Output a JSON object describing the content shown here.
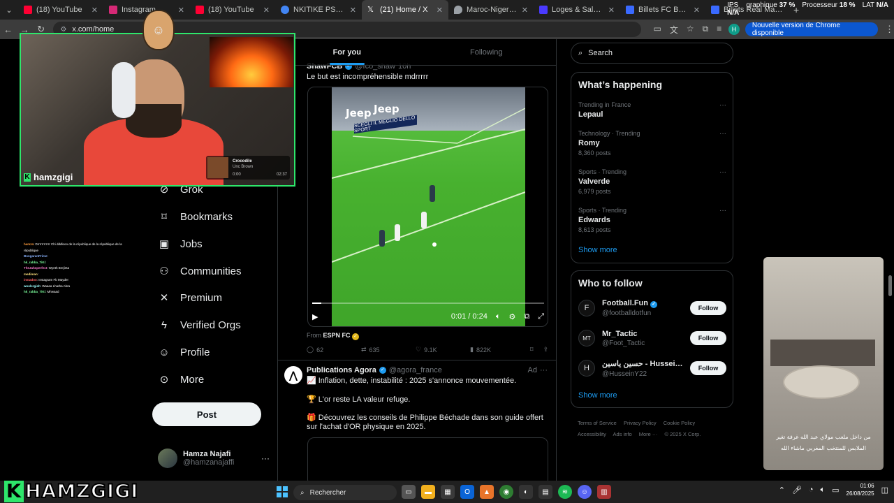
{
  "browser": {
    "tabs": [
      {
        "title": "(18) YouTube",
        "icon": "youtube-icon",
        "color": "#ff0033"
      },
      {
        "title": "Instagram",
        "icon": "instagram-icon",
        "color": "#d62976"
      },
      {
        "title": "(18) YouTube",
        "icon": "youtube-icon",
        "color": "#ff0033"
      },
      {
        "title": "NKITIKE PSGH - Rech",
        "icon": "google-icon",
        "color": "#4285f4"
      },
      {
        "title": "(21) Home / X",
        "icon": "x-icon",
        "color": "#ffffff"
      },
      {
        "title": "Maroc-Niger : billett",
        "icon": "map-pin-icon",
        "color": "#9aa0a6"
      },
      {
        "title": "Loges & Salons VIP",
        "icon": "bookmark-site-icon",
        "color": "#4a3aff"
      },
      {
        "title": "Billets FC Barcelona",
        "icon": "ticket-site-icon",
        "color": "#3a6aff"
      },
      {
        "title": "Billets Real Madrid",
        "icon": "ticket-site-icon",
        "color": "#3a6aff"
      }
    ],
    "url": "x.com/home",
    "update_label": "Nouvelle version de Chrome disponible",
    "profile_initial": "H"
  },
  "system_stats": {
    "ips_label": "IPS",
    "ips_value": "N/A",
    "gpu_label": "graphique",
    "gpu_value": "37 %",
    "cpu_label": "Processeur",
    "cpu_value": "18 %",
    "lat_label": "LAT",
    "lat_value": "N/A"
  },
  "sidebar": {
    "items": [
      {
        "label": "Grok",
        "icon": "grok-icon"
      },
      {
        "label": "Bookmarks",
        "icon": "bookmark-icon"
      },
      {
        "label": "Jobs",
        "icon": "briefcase-icon"
      },
      {
        "label": "Communities",
        "icon": "communities-icon"
      },
      {
        "label": "Premium",
        "icon": "x-logo-icon"
      },
      {
        "label": "Verified Orgs",
        "icon": "lightning-icon"
      },
      {
        "label": "Profile",
        "icon": "profile-icon"
      },
      {
        "label": "More",
        "icon": "more-circle-icon"
      }
    ],
    "post_label": "Post",
    "account": {
      "name": "Hamza Najafi",
      "handle": "@hamzanajaffi"
    }
  },
  "timeline": {
    "tabs": [
      "For you",
      "Following"
    ],
    "tweet1": {
      "name": "ShawFCB",
      "handle": "@fco_shaw",
      "badge": "illisible",
      "time": "10h",
      "text": "Le but est incompréhensible mdrrrrr",
      "board_text": "Jeep",
      "banner_text": "SCEGLI IL MEGLIO DELLO SPORT",
      "video_time": "0:01 / 0:24",
      "video_progress": 0.04,
      "from_label": "From",
      "from_source": "ESPN FC",
      "replies": "62",
      "reposts": "635",
      "likes": "9.1K",
      "views": "822K"
    },
    "tweet2": {
      "name": "Publications Agora",
      "handle": "@agora_france",
      "ad_label": "Ad",
      "line1": "📈 Inflation, dette, instabilité : 2025 s'annonce mouvementée.",
      "line2": "🏆 L'or reste LA valeur refuge.",
      "line3": "🎁 Découvrez les conseils de Philippe Béchade dans son guide offert sur l'achat d'OR physique en 2025."
    }
  },
  "right": {
    "search_placeholder": "Search",
    "happening_title": "What’s happening",
    "trends": [
      {
        "context": "Trending in France",
        "topic": "Lepaul",
        "posts": ""
      },
      {
        "context": "Technology · Trending",
        "topic": "Romy",
        "posts": "8,360 posts"
      },
      {
        "context": "Sports · Trending",
        "topic": "Valverde",
        "posts": "6,979 posts"
      },
      {
        "context": "Sports · Trending",
        "topic": "Edwards",
        "posts": "8,613 posts"
      }
    ],
    "show_more": "Show more",
    "wtf_title": "Who to follow",
    "follow_label": "Follow",
    "suggestions": [
      {
        "name": "Football.Fun",
        "handle": "@footballdotfun",
        "avatar": "F"
      },
      {
        "name": "Mr_Tactic",
        "handle": "@Foot_Tactic",
        "avatar": "MT"
      },
      {
        "name": "حسين ياسين - Hussei...",
        "handle": "@HusseinY22",
        "avatar": "H"
      }
    ],
    "footer": [
      "Terms of Service",
      "Privacy Policy",
      "Cookie Policy",
      "Accessibility",
      "Ads info",
      "More ···",
      "© 2025 X Corp."
    ]
  },
  "overlay": {
    "streamer_name": "hamzgigi",
    "now_playing_title": "Crocodile",
    "now_playing_artist": "Unc Brown",
    "now_playing_start": "0:00",
    "now_playing_end": "02:37",
    "chat": [
      {
        "user": "hamza",
        "msg": ": Drrrrrrrrrrrr Chi dddlooo de la république de la république de la république"
      },
      {
        "user": "BongaranPrime",
        "msg": ": "
      },
      {
        "user": "hk_rabba_TiKi",
        "msg": ": "
      },
      {
        "user": "TheJahsperfect",
        "msg": ": Wyeth Brejinta"
      },
      {
        "user": "mediman",
        "msg": ": "
      },
      {
        "user": "instadoo",
        "msg": ": Instagram Fb Mayder"
      },
      {
        "user": "woolergish",
        "msg": ": Waaaa Lharba Abra"
      },
      {
        "user": "hk_rabba_TiKi",
        "msg": ": Mhwaad"
      }
    ],
    "side_video_caption": "من داخل ملعب مولاي عبد الله غرفة تغير الملابس للمنتخب المغربي ماشاء الله",
    "brand_k": "K",
    "brand_rest": "HAMZGIGI"
  },
  "taskbar": {
    "search_label": "Rechercher",
    "time": "01:06",
    "date": "26/08/2025"
  },
  "colors": {
    "accent": "#1d9bf0",
    "stream_green": "#2ee66b"
  }
}
